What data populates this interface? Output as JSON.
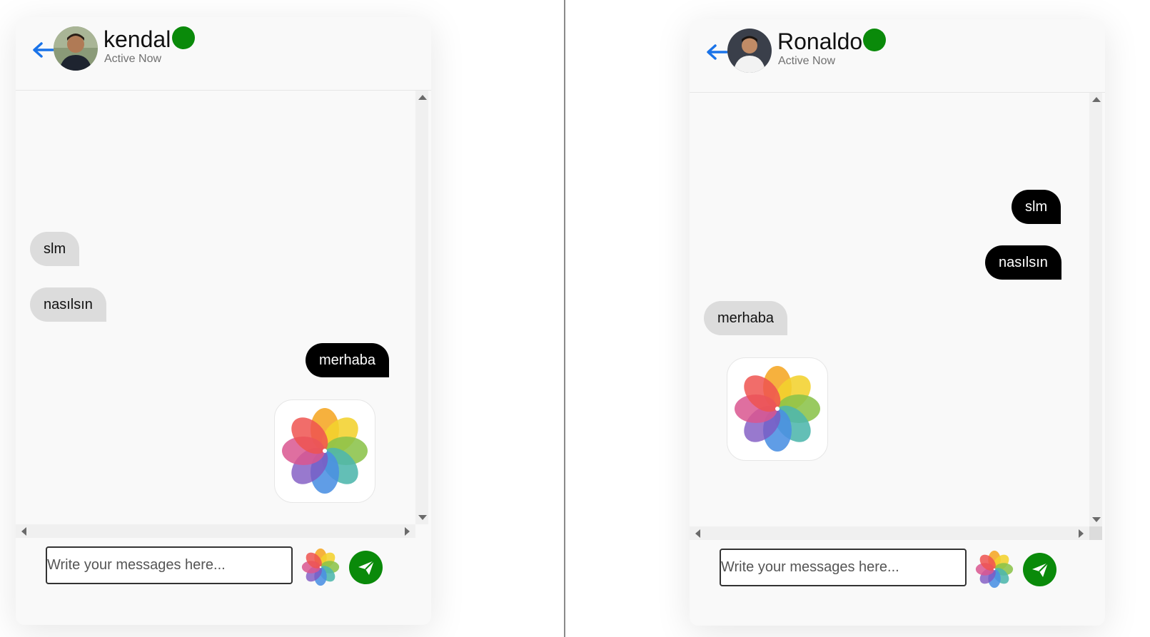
{
  "chats": [
    {
      "contact_name": "kendal",
      "status": "Active Now",
      "messages": [
        {
          "text": "slm",
          "direction": "incoming"
        },
        {
          "text": "nasılsın",
          "direction": "incoming"
        },
        {
          "text": "merhaba",
          "direction": "outgoing"
        }
      ],
      "composer": {
        "placeholder": "Write your messages here..."
      }
    },
    {
      "contact_name": "Ronaldo",
      "status": "Active Now",
      "messages": [
        {
          "text": "slm",
          "direction": "outgoing"
        },
        {
          "text": "nasılsın",
          "direction": "outgoing"
        },
        {
          "text": "merhaba",
          "direction": "incoming"
        }
      ],
      "composer": {
        "placeholder": "Write your messages here..."
      }
    }
  ],
  "colors": {
    "online": "#0a8a0a",
    "outgoing_bubble": "#000000",
    "incoming_bubble": "#dcdcdc",
    "send_button": "#0a8a0a",
    "back_arrow": "#1a73e8"
  },
  "icons": [
    "back-arrow-icon",
    "avatar",
    "online-indicator",
    "photos-icon",
    "send-icon"
  ]
}
